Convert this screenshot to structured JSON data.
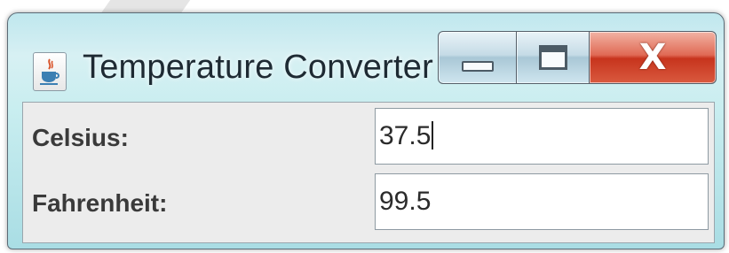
{
  "window": {
    "title": "Temperature Converter",
    "icon": "java-cup-icon",
    "controls": {
      "minimize": "minimize",
      "maximize": "maximize",
      "close_glyph": "X"
    }
  },
  "form": {
    "celsius": {
      "label": "Celsius:",
      "value": "37.5"
    },
    "fahrenheit": {
      "label": "Fahrenheit:",
      "value": "99.5"
    }
  },
  "colors": {
    "title_bar": "#c9eef0",
    "close_button": "#d9472f",
    "panel": "#ececec"
  }
}
